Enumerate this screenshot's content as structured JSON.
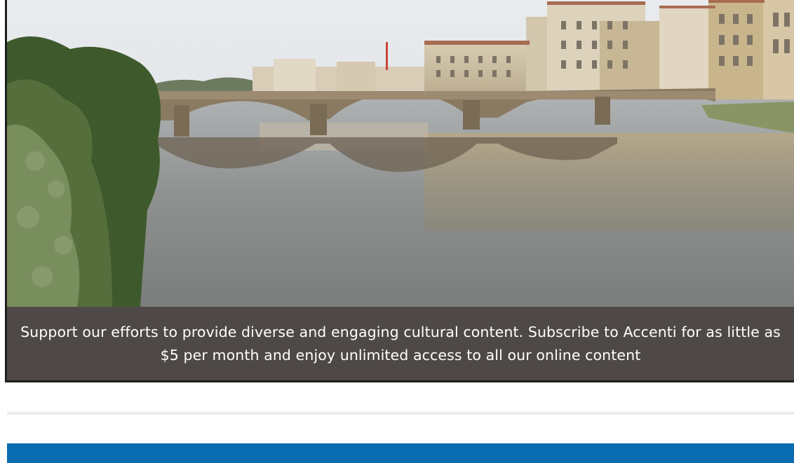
{
  "promo": {
    "image_alt": "Bridge over a river reflecting a row of historic buildings",
    "caption": "Support our efforts to provide diverse and engaging cultural content. Subscribe to Accenti for as little as $5 per month and enjoy unlimited access to all our online content"
  },
  "colors": {
    "caption_bg": "#4e4946",
    "caption_text": "#ffffff",
    "divider": "#ececec",
    "band": "#0a6cb0"
  }
}
